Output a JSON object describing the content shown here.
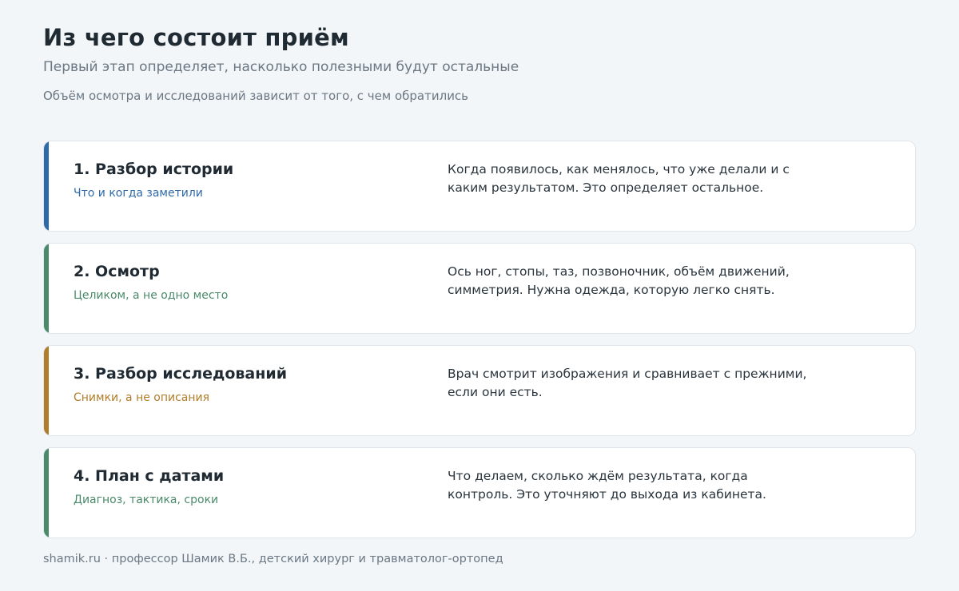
{
  "header": {
    "title": "Из чего состоит приём",
    "subtitle": "Первый этап определяет, насколько полезными будут остальные",
    "note": "Объём осмотра и исследований зависит от того, с чем обратились"
  },
  "colors": {
    "blue": "#2f6aa8",
    "green": "#4a8a6a",
    "amber": "#b07d2a"
  },
  "steps": [
    {
      "heading": "1. Разбор истории",
      "tag": "Что и когда заметили",
      "desc": "Когда появилось, как менялось, что уже делали и с каким результатом. Это определяет остальное.",
      "color": "#2f6aa8"
    },
    {
      "heading": "2. Осмотр",
      "tag": "Целиком, а не одно место",
      "desc": "Ось ног, стопы, таз, позвоночник, объём движений, симметрия. Нужна одежда, которую легко снять.",
      "color": "#4a8a6a"
    },
    {
      "heading": "3. Разбор исследований",
      "tag": "Снимки, а не описания",
      "desc": "Врач смотрит изображения и сравнивает с прежними, если они есть.",
      "color": "#b07d2a"
    },
    {
      "heading": "4. План с датами",
      "tag": "Диагноз, тактика, сроки",
      "desc": "Что делаем, сколько ждём результата, когда контроль. Это уточняют до выхода из кабинета.",
      "color": "#4a8a6a"
    }
  ],
  "footer": {
    "text": "shamik.ru · профессор Шамик В.Б., детский хирург и травматолог-ортопед"
  }
}
